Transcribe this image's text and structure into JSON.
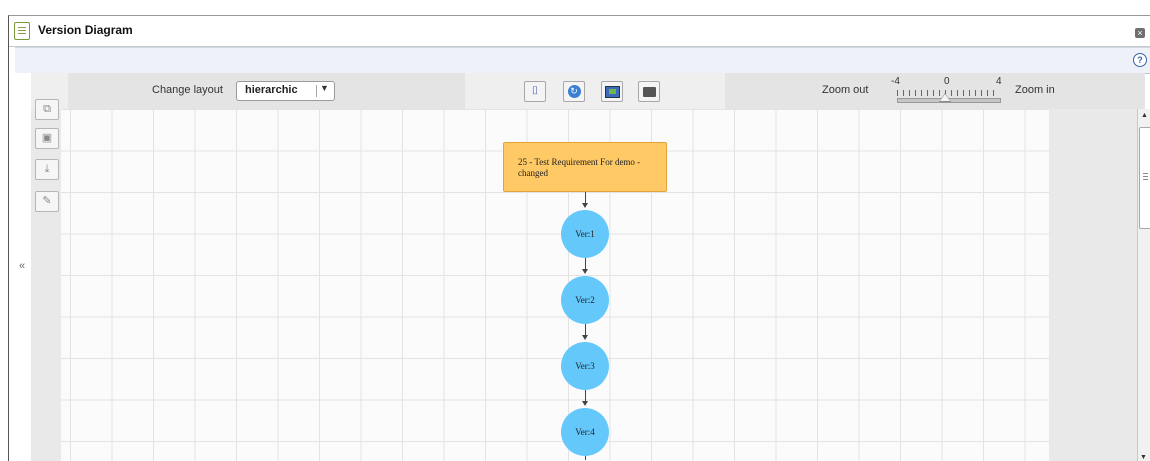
{
  "window": {
    "title": "Version Diagram"
  },
  "toolbar": {
    "change_layout_label": "Change layout",
    "layout_value": "hierarchic",
    "zoom_out_label": "Zoom out",
    "zoom_in_label": "Zoom in",
    "zoom_min": "-4",
    "zoom_mid": "0",
    "zoom_max": "4",
    "zoom_level": 0
  },
  "diagram": {
    "requirement_node": "25 - Test Requirement For demo - changed",
    "versions": [
      "Ver:1",
      "Ver:2",
      "Ver:3",
      "Ver:4"
    ]
  },
  "colors": {
    "requirement_fill": "#ffc966",
    "version_fill": "#64c8fb",
    "toolbar_bg": "#e4e4e4"
  }
}
